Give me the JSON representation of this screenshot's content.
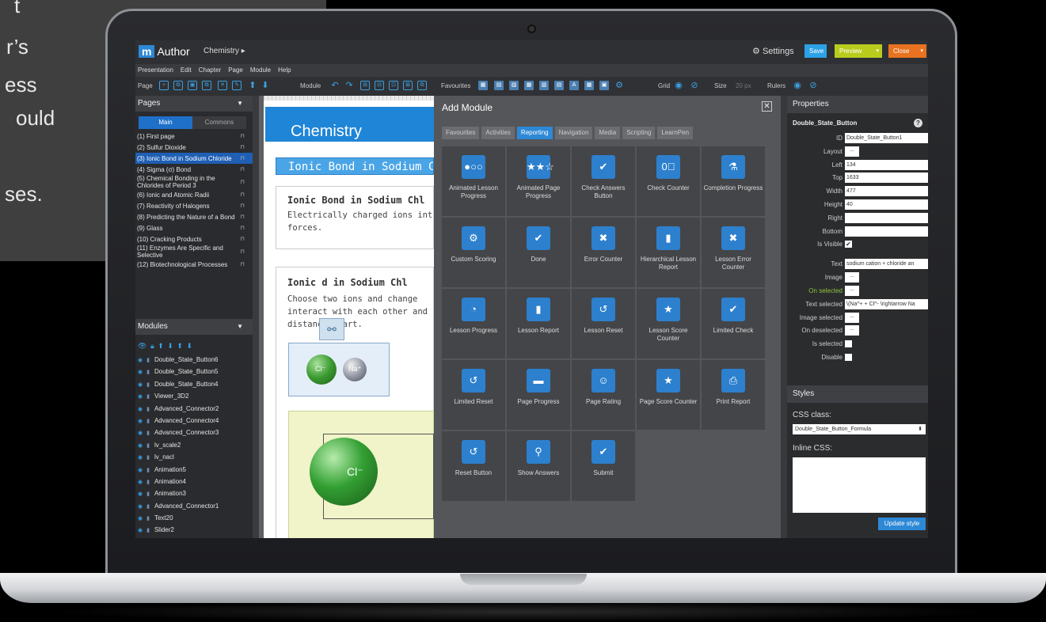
{
  "promo": {
    "lines": [
      "t",
      "r’s",
      "ess",
      "ould",
      "ses."
    ]
  },
  "app": {
    "logo_m": "m",
    "logo_rest": "Author",
    "breadcrumb": "Chemistry ▸",
    "settings": "Settings",
    "save": "Save",
    "preview": "Preview",
    "close": "Close"
  },
  "menu": [
    "Presentation",
    "Edit",
    "Chapter",
    "Page",
    "Module",
    "Help"
  ],
  "toolbar": {
    "page_label": "Page",
    "module_label": "Module",
    "favourites_label": "Favourites",
    "grid_label": "Grid",
    "size_label": "Size",
    "size_value": "20 px",
    "rulers_label": "Rulers"
  },
  "pages_panel": {
    "title": "Pages",
    "tabs": [
      "Main",
      "Commons"
    ],
    "items": [
      "(1) First page",
      "(2) Sulfur Dioxide",
      "(3) Ionic Bond in Sodium Chloride",
      "(4) Sigma (σ) Bond",
      "(5) Chemical Bonding in the Chlorides of Period 3",
      "(6) Ionic and Atomic Radii",
      "(7) Reactivity of Halogens",
      "(8) Predicting the Nature of a Bond",
      "(9) Glass",
      "(10) Cracking Products",
      "(11) Enzymes Are Specific and Selective",
      "(12) Biotechnological Processes"
    ],
    "active_index": 2
  },
  "modules_panel": {
    "title": "Modules",
    "items": [
      "Double_State_Button6",
      "Double_State_Button5",
      "Double_State_Button4",
      "Viewer_3D2",
      "Advanced_Connector2",
      "Advanced_Connector4",
      "Advanced_Connector3",
      "lv_scale2",
      "lv_nacl",
      "Animation5",
      "Animation4",
      "Animation3",
      "Advanced_Connector1",
      "Text20",
      "Slider2"
    ]
  },
  "canvas": {
    "title": "Chemistry",
    "subtitle": "Ionic Bond in Sodium C",
    "box1_title": "Ionic Bond in Sodium Chl",
    "box1_text": [
      "Electrically charged ions inter",
      "forces."
    ],
    "box2_title": "Ionic    d in Sodium Chl",
    "box2_text": [
      "Choose two ions and change",
      "interact with each other and h",
      "distance apart."
    ],
    "atom_cl": "Cl⁻",
    "atom_na": "Na⁺",
    "big_atom": "Cl⁻"
  },
  "dialog": {
    "title": "Add Module",
    "tabs": [
      "Favourites",
      "Activities",
      "Reporting",
      "Navigation",
      "Media",
      "Scripting",
      "LearnPen"
    ],
    "active_tab": 2,
    "modules": [
      {
        "label": "Animated Lesson Progress",
        "icon": "●○○"
      },
      {
        "label": "Animated Page Progress",
        "icon": "★★☆"
      },
      {
        "label": "Check Answers Button",
        "icon": "✔"
      },
      {
        "label": "Check Counter",
        "icon": "0⃣"
      },
      {
        "label": "Completion Progress",
        "icon": "⚗"
      },
      {
        "label": "Custom Scoring",
        "icon": "⚙"
      },
      {
        "label": "Done",
        "icon": "✔"
      },
      {
        "label": "Error Counter",
        "icon": "✖"
      },
      {
        "label": "Hierarchical Lesson Report",
        "icon": "▮"
      },
      {
        "label": "Lesson Error Counter",
        "icon": "✖"
      },
      {
        "label": "Lesson Progress",
        "icon": "◔"
      },
      {
        "label": "Lesson Report",
        "icon": "▮"
      },
      {
        "label": "Lesson Reset",
        "icon": "↺"
      },
      {
        "label": "Lesson Score Counter",
        "icon": "★"
      },
      {
        "label": "Limited Check",
        "icon": "✔"
      },
      {
        "label": "Limited Reset",
        "icon": "↺"
      },
      {
        "label": "Page Progress",
        "icon": "▬"
      },
      {
        "label": "Page Rating",
        "icon": "☺"
      },
      {
        "label": "Page Score Counter",
        "icon": "★"
      },
      {
        "label": "Print Report",
        "icon": "⎙"
      },
      {
        "label": "Reset Button",
        "icon": "↺"
      },
      {
        "label": "Show Answers",
        "icon": "⚲"
      },
      {
        "label": "Submit",
        "icon": "✔"
      }
    ]
  },
  "properties": {
    "title": "Properties",
    "module_name": "Double_State_Button",
    "fields": [
      {
        "label": "ID",
        "type": "text",
        "value": "Double_State_Button1"
      },
      {
        "label": "Layout",
        "type": "button",
        "value": "..."
      },
      {
        "label": "Left",
        "type": "text",
        "value": "134"
      },
      {
        "label": "Top",
        "type": "text",
        "value": "1633"
      },
      {
        "label": "Width",
        "type": "text",
        "value": "477"
      },
      {
        "label": "Height",
        "type": "text",
        "value": "40"
      },
      {
        "label": "Right",
        "type": "text",
        "value": ""
      },
      {
        "label": "Bottom",
        "type": "text",
        "value": ""
      },
      {
        "label": "Is Visible",
        "type": "check",
        "value": "✔"
      },
      {
        "label": "Text",
        "type": "text",
        "value": "sodium cation + chloride an"
      },
      {
        "label": "Image",
        "type": "button",
        "value": "..."
      },
      {
        "label": "On selected",
        "type": "button",
        "value": "...",
        "green": true
      },
      {
        "label": "Text selected",
        "type": "text",
        "value": "\\(Na^+ + Cl^- \\rightarrow Na"
      },
      {
        "label": "Image selected",
        "type": "button",
        "value": "..."
      },
      {
        "label": "On deselected",
        "type": "button",
        "value": "..."
      },
      {
        "label": "Is selected",
        "type": "check",
        "value": ""
      },
      {
        "label": "Disable",
        "type": "check",
        "value": ""
      }
    ],
    "styles_title": "Styles",
    "css_class_label": "CSS class:",
    "css_class_value": "Double_State_Button_Formula",
    "inline_css_label": "Inline CSS:",
    "update_style": "Update style"
  },
  "colors": {
    "accent": "#2d88d6",
    "preview": "#b9cc1e",
    "close": "#e8721f"
  }
}
